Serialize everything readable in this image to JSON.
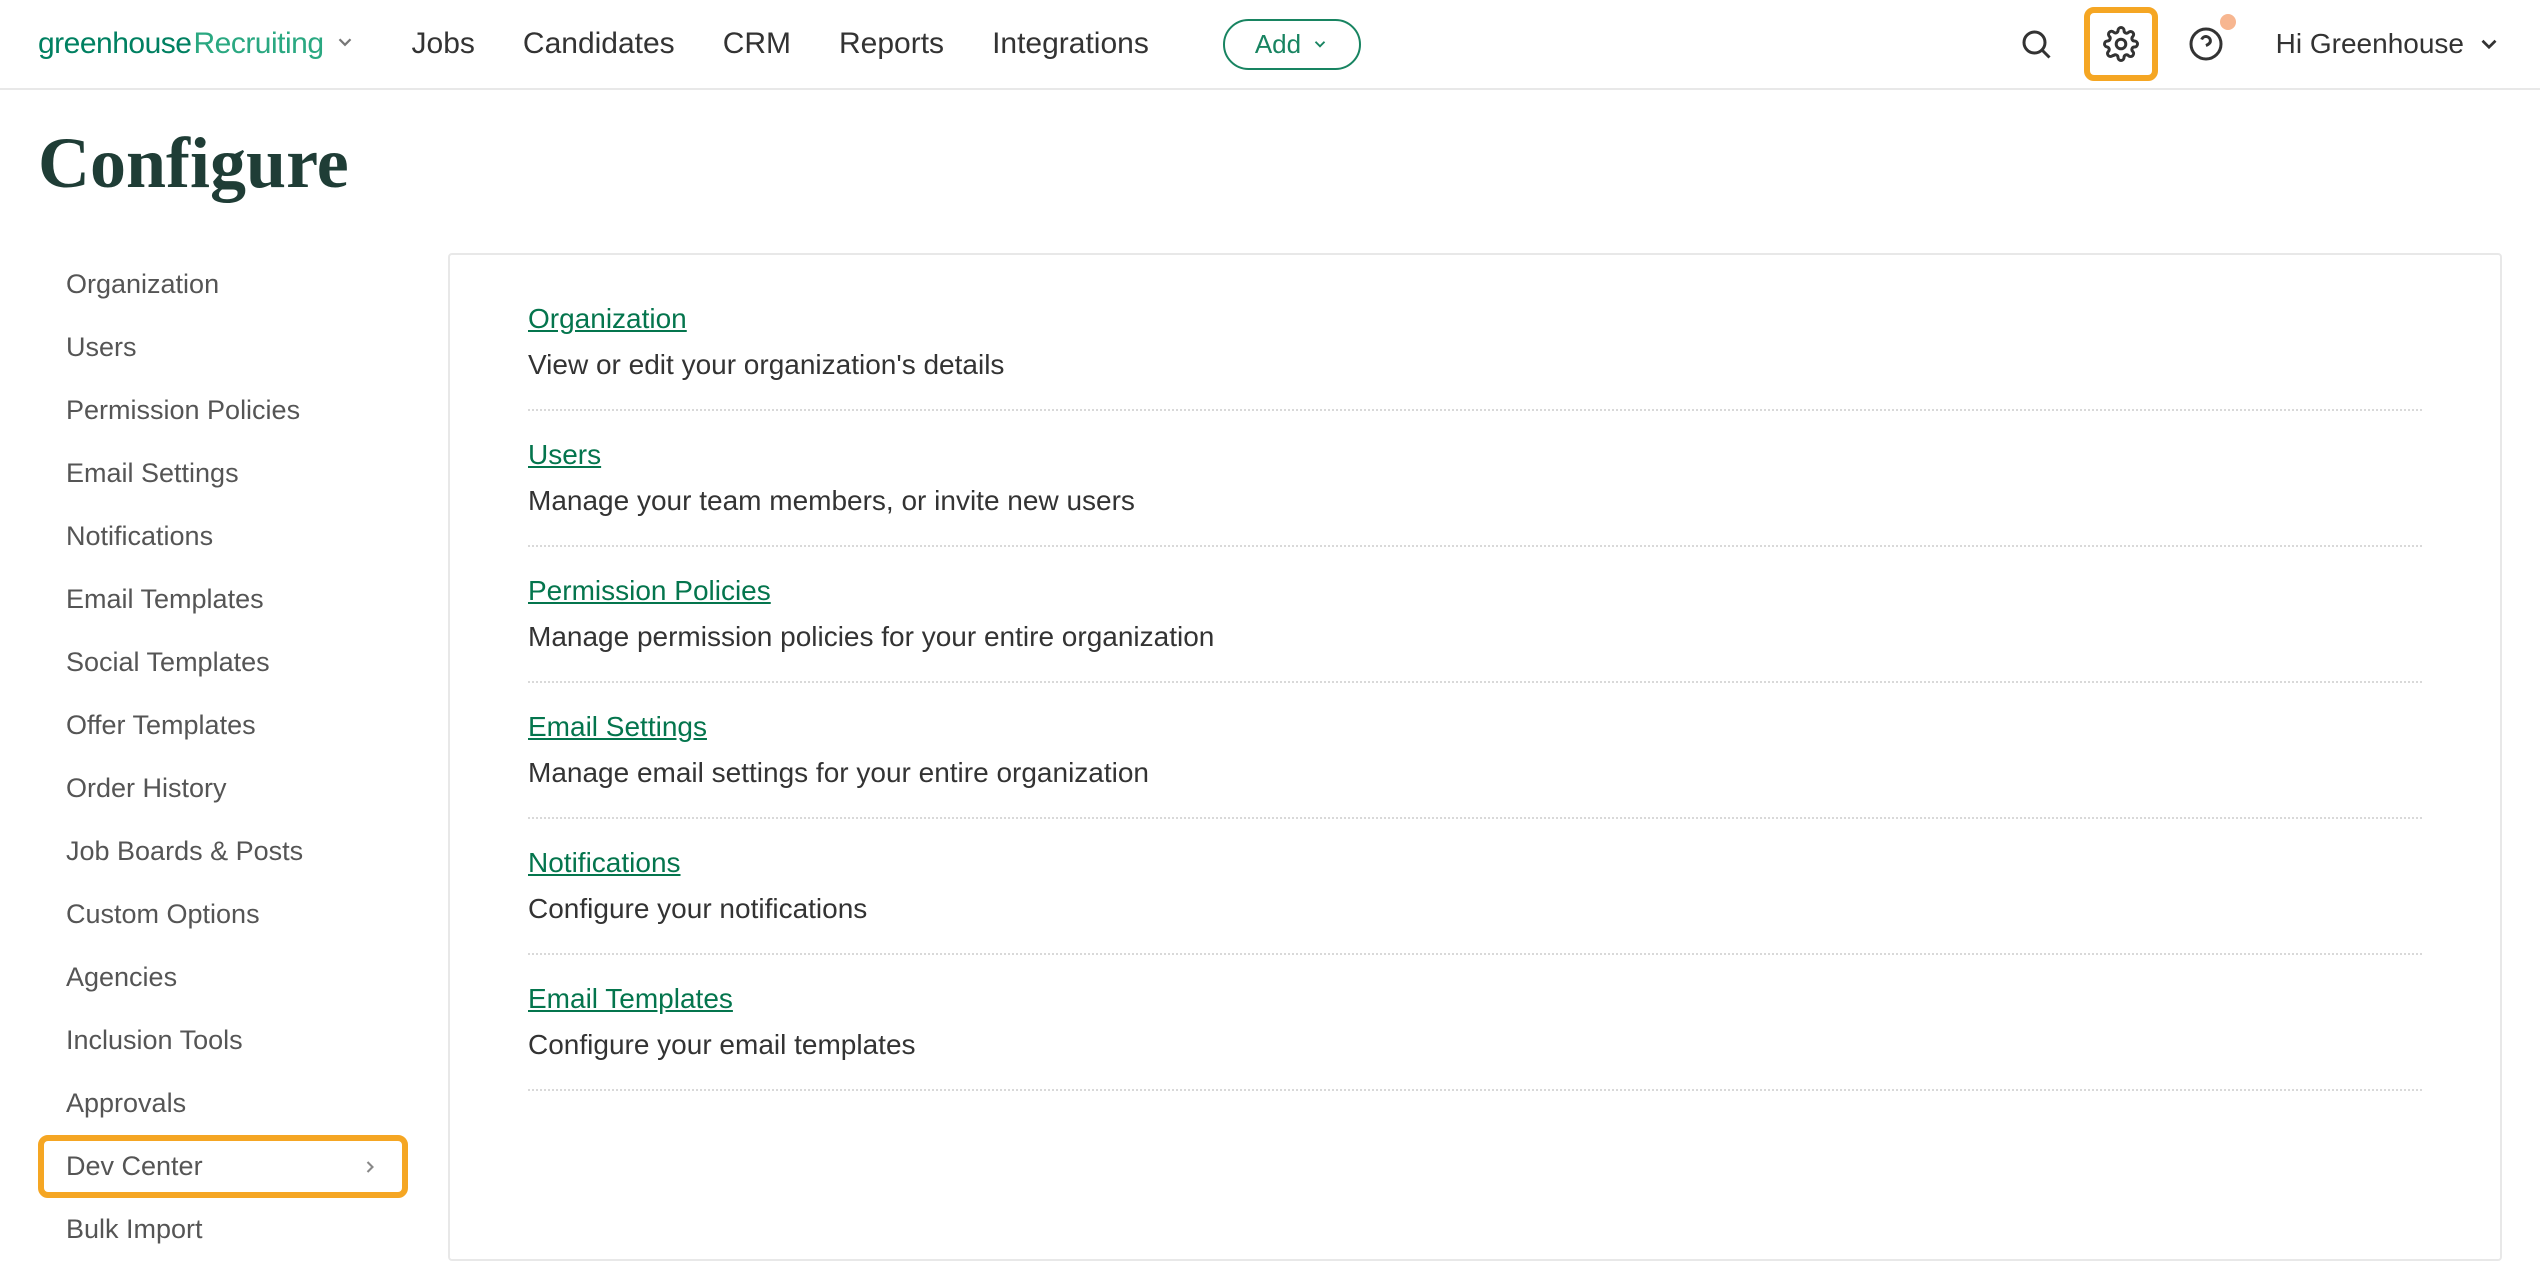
{
  "logo": {
    "part1": "greenhouse",
    "part2": "Recruiting"
  },
  "nav": {
    "jobs": "Jobs",
    "candidates": "Candidates",
    "crm": "CRM",
    "reports": "Reports",
    "integrations": "Integrations"
  },
  "add_button": "Add",
  "user_greeting": "Hi Greenhouse",
  "page_title": "Configure",
  "sidebar": {
    "items": [
      {
        "label": "Organization"
      },
      {
        "label": "Users"
      },
      {
        "label": "Permission Policies"
      },
      {
        "label": "Email Settings"
      },
      {
        "label": "Notifications"
      },
      {
        "label": "Email Templates"
      },
      {
        "label": "Social Templates"
      },
      {
        "label": "Offer Templates"
      },
      {
        "label": "Order History"
      },
      {
        "label": "Job Boards & Posts"
      },
      {
        "label": "Custom Options"
      },
      {
        "label": "Agencies"
      },
      {
        "label": "Inclusion Tools"
      },
      {
        "label": "Approvals"
      },
      {
        "label": "Dev Center",
        "highlighted": true,
        "has_chevron": true
      },
      {
        "label": "Bulk Import"
      }
    ]
  },
  "sections": [
    {
      "title": "Organization",
      "desc": "View or edit your organization's details"
    },
    {
      "title": "Users",
      "desc": "Manage your team members, or invite new users"
    },
    {
      "title": "Permission Policies",
      "desc": "Manage permission policies for your entire organization"
    },
    {
      "title": "Email Settings",
      "desc": "Manage email settings for your entire organization"
    },
    {
      "title": "Notifications",
      "desc": "Configure your notifications"
    },
    {
      "title": "Email Templates",
      "desc": "Configure your email templates"
    }
  ]
}
